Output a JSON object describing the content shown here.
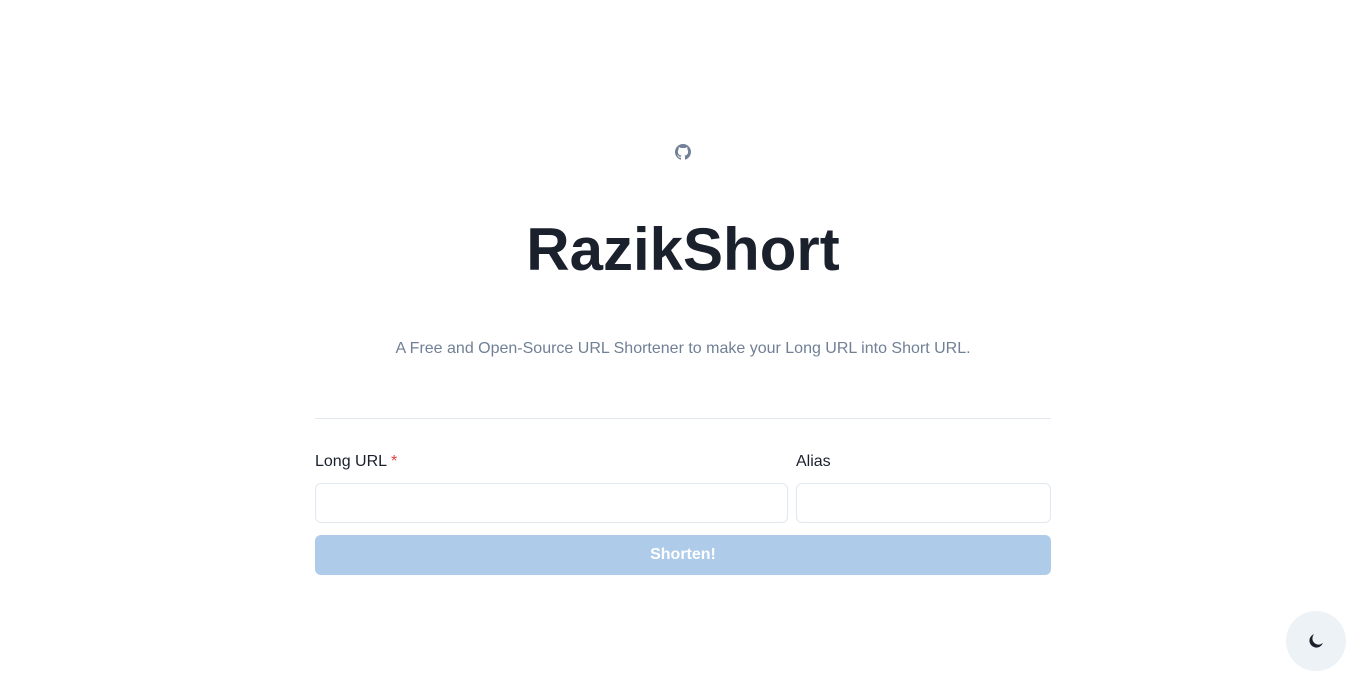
{
  "header": {
    "github_icon": "github-icon",
    "title": "RazikShort",
    "subtitle": "A Free and Open-Source URL Shortener to make your Long URL into Short URL."
  },
  "form": {
    "long_url": {
      "label": "Long URL",
      "required_mark": "*",
      "value": "",
      "placeholder": ""
    },
    "alias": {
      "label": "Alias",
      "value": "",
      "placeholder": ""
    },
    "submit_label": "Shorten!"
  },
  "theme_toggle": {
    "icon": "moon-icon"
  },
  "colors": {
    "title": "#1a202c",
    "subtitle": "#718096",
    "button_disabled": "#aecbea",
    "required": "#e53e3e",
    "toggle_bg": "#edf2f7"
  }
}
